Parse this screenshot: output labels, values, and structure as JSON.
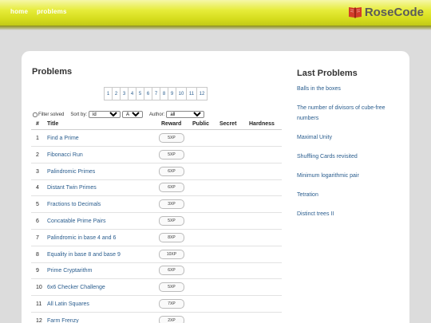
{
  "nav": {
    "home": "home",
    "problems": "problems"
  },
  "brand": {
    "name": "RoseCode",
    "icon": "red-book-icon",
    "color": "#d23c2a"
  },
  "main": {
    "title": "Problems"
  },
  "pagination": [
    "1",
    "2",
    "3",
    "4",
    "5",
    "6",
    "7",
    "8",
    "9",
    "10",
    "11",
    "12"
  ],
  "filters": {
    "filter_solved_label": "Filter solved",
    "sort_by_label": "Sort by:",
    "sort_by_value": "id",
    "order_value": "ASC",
    "author_label": "Author:",
    "author_value": "all"
  },
  "table": {
    "headers": [
      "#",
      "Title",
      "Reward",
      "Public",
      "Secret",
      "Hardness"
    ],
    "rows": [
      {
        "num": "1",
        "title": "Find a Prime",
        "reward": "5XP"
      },
      {
        "num": "2",
        "title": "Fibonacci Run",
        "reward": "5XP"
      },
      {
        "num": "3",
        "title": "Palindromic Primes",
        "reward": "6XP"
      },
      {
        "num": "4",
        "title": "Distant Twin Primes",
        "reward": "6XP"
      },
      {
        "num": "5",
        "title": "Fractions to Decimals",
        "reward": "3XP"
      },
      {
        "num": "6",
        "title": "Concatable Prime Pairs",
        "reward": "5XP"
      },
      {
        "num": "7",
        "title": "Palindromic in base 4 and 6",
        "reward": "8XP"
      },
      {
        "num": "8",
        "title": "Equality in base 8 and base 9",
        "reward": "10XP"
      },
      {
        "num": "9",
        "title": "Prime Cryptarithm",
        "reward": "6XP"
      },
      {
        "num": "10",
        "title": "6x6 Checker Challenge",
        "reward": "5XP"
      },
      {
        "num": "11",
        "title": "All Latin Squares",
        "reward": "7XP"
      },
      {
        "num": "12",
        "title": "Farm Frenzy",
        "reward": "2XP"
      }
    ]
  },
  "sidebar": {
    "title": "Last Problems",
    "items": [
      "Balls in the boxes",
      "The number of divisors of cube-free numbers",
      "Maximal Unity",
      "Shuffling Cards revisited",
      "Minimum logarithmic pair",
      "Tetration",
      "Distinct trees II"
    ]
  }
}
